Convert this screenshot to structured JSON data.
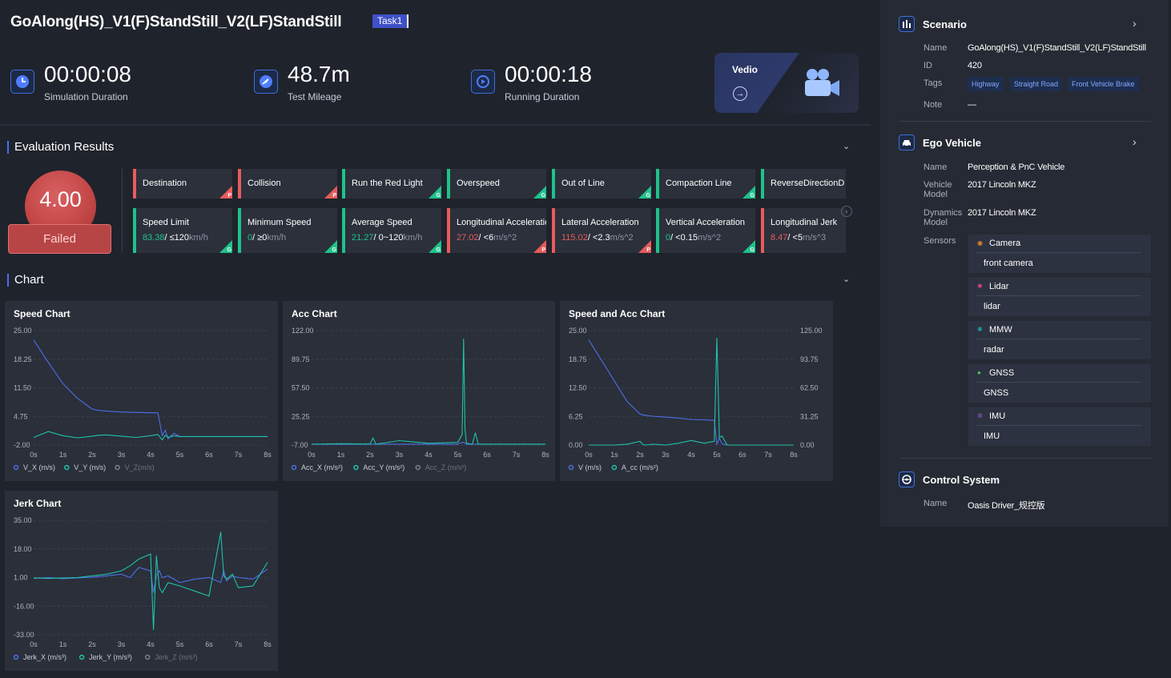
{
  "header": {
    "title": "GoAlong(HS)_V1(F)StandStill_V2(LF)StandStill",
    "task": "Task1"
  },
  "metrics": [
    {
      "value": "00:00:08",
      "label": "Simulation Duration",
      "icon": "clock-icon"
    },
    {
      "value": "48.7m",
      "label": "Test Mileage",
      "icon": "gauge-icon"
    },
    {
      "value": "00:00:18",
      "label": "Running Duration",
      "icon": "replay-icon"
    }
  ],
  "vedio": {
    "label": "Vedio"
  },
  "evaluation": {
    "title": "Evaluation Results",
    "score": "4.00",
    "status": "Failed",
    "colors": {
      "fail": "#e85b5b",
      "pass": "#1fc28a"
    },
    "row1": [
      {
        "name": "Destination",
        "flag": "P",
        "pass": false
      },
      {
        "name": "Collision",
        "flag": "P",
        "pass": false
      },
      {
        "name": "Run the Red Light",
        "flag": "G",
        "pass": true
      },
      {
        "name": "Overspeed",
        "flag": "G",
        "pass": true
      },
      {
        "name": "Out of Line",
        "flag": "G",
        "pass": true
      },
      {
        "name": "Compaction Line",
        "flag": "G",
        "pass": true
      },
      {
        "name": "ReverseDirectionD",
        "flag": "G",
        "pass": true
      }
    ],
    "row2": [
      {
        "name": "Speed Limit",
        "value": "83.38",
        "limit": "/ ≤120",
        "unit": "km/h",
        "flag": "G",
        "pass": true
      },
      {
        "name": "Minimum Speed",
        "value": "0",
        "limit": "/ ≥0",
        "unit": "km/h",
        "flag": "G",
        "pass": true
      },
      {
        "name": "Average Speed",
        "value": "21.27",
        "limit": "/ 0~120",
        "unit": "km/h",
        "flag": "G",
        "pass": true
      },
      {
        "name": "Longitudinal Acceleration",
        "value": "27.02",
        "limit": "/ <6",
        "unit": "m/s^2",
        "flag": "P",
        "pass": false
      },
      {
        "name": "Lateral Acceleration",
        "value": "115.02",
        "limit": "/ <2.3",
        "unit": "m/s^2",
        "flag": "P",
        "pass": false
      },
      {
        "name": "Vertical Acceleration",
        "value": "0",
        "limit": "/ <0.15",
        "unit": "m/s^2",
        "flag": "G",
        "pass": true
      },
      {
        "name": "Longitudinal Jerk",
        "value": "8.47",
        "limit": "/ <5",
        "unit": "m/s^3",
        "flag": "P",
        "pass": false
      }
    ]
  },
  "chart_section": {
    "title": "Chart"
  },
  "chart_data": [
    {
      "type": "line",
      "title": "Speed Chart",
      "x": [
        0,
        0.5,
        1,
        1.5,
        2,
        2.2,
        2.5,
        3,
        3.5,
        4,
        4.25,
        4.4,
        4.5,
        4.6,
        4.8,
        5,
        6,
        7,
        8
      ],
      "xticks": [
        "0s",
        "1s",
        "2s",
        "3s",
        "4s",
        "5s",
        "6s",
        "7s",
        "8s"
      ],
      "yticks": [
        "25.00",
        "18.25",
        "11.50",
        "4.75",
        "-2.00"
      ],
      "ylim": [
        -2,
        25
      ],
      "grid": true,
      "legend": "bottom-left",
      "series": [
        {
          "name": "V_X (m/s)",
          "color": "#4f6ee8",
          "values": [
            22.8,
            17.5,
            12.5,
            9,
            6.5,
            6.2,
            6,
            5.8,
            5.7,
            5.6,
            5.6,
            0.2,
            1.5,
            -0.5,
            0.8,
            0,
            0,
            0,
            0
          ]
        },
        {
          "name": "V_Y (m/s)",
          "color": "#1fc2a8",
          "values": [
            -0.2,
            1.2,
            0.2,
            -0.3,
            0.1,
            0.3,
            0.4,
            0.1,
            -0.2,
            0.2,
            0.5,
            -0.8,
            0.3,
            -0.2,
            0.2,
            0,
            0,
            0,
            0
          ]
        },
        {
          "name": "V_Z(m/s)",
          "color": "#7a8190",
          "values": [],
          "dimmed": true
        }
      ]
    },
    {
      "type": "line",
      "title": "Acc Chart",
      "x": [
        0,
        1,
        2,
        2.1,
        2.2,
        3,
        4,
        5,
        5.15,
        5.2,
        5.25,
        5.3,
        5.5,
        5.6,
        5.7,
        6,
        7,
        8
      ],
      "xticks": [
        "0s",
        "1s",
        "2s",
        "3s",
        "4s",
        "5s",
        "6s",
        "7s",
        "8s"
      ],
      "yticks": [
        "122.00",
        "89.75",
        "57.50",
        "25.25",
        "-7.00"
      ],
      "ylim": [
        -7,
        122
      ],
      "grid": true,
      "legend": "bottom-left",
      "series": [
        {
          "name": "Acc_X (m/s²)",
          "color": "#4f6ee8",
          "values": [
            -6,
            -6,
            -6,
            -6,
            -6,
            -6,
            -6,
            -6,
            -4,
            -4,
            -5,
            -6,
            -6,
            -6,
            -6,
            -6,
            -6,
            -6
          ]
        },
        {
          "name": "Acc_Y (m/s²)",
          "color": "#1fc2a8",
          "values": [
            -6,
            -5.5,
            -5.8,
            1,
            -6,
            -2,
            -5,
            -4,
            5,
            113,
            10,
            -5,
            -6,
            7,
            -6,
            -6,
            -6,
            -6
          ]
        },
        {
          "name": "Acc_Z (m/s²)",
          "color": "#7a8190",
          "values": [],
          "dimmed": true
        }
      ]
    },
    {
      "type": "line",
      "title": "Speed and Acc Chart",
      "x": [
        0,
        0.5,
        1,
        1.5,
        2,
        2.1,
        2.2,
        2.5,
        3,
        3.5,
        4,
        4.5,
        4.9,
        5,
        5.1,
        5.2,
        5.4,
        6,
        7,
        8
      ],
      "xticks": [
        "0s",
        "1s",
        "2s",
        "3s",
        "4s",
        "5s",
        "6s",
        "7s",
        "8s"
      ],
      "yticks": [
        "25.00",
        "18.75",
        "12.50",
        "6.25",
        "0.00"
      ],
      "yticks_right": [
        "125.00",
        "93.75",
        "62.50",
        "31.25",
        "0.00"
      ],
      "ylim": [
        0,
        25
      ],
      "ylim_right": [
        0,
        125
      ],
      "grid": true,
      "legend": "bottom-left",
      "series": [
        {
          "name": "V (m/s)",
          "color": "#4f6ee8",
          "values": [
            23,
            18.5,
            14,
            9.5,
            6.8,
            6.6,
            6.5,
            6.3,
            6.1,
            5.9,
            5.6,
            5.5,
            5.4,
            0.2,
            1.5,
            0.3,
            0,
            0,
            0,
            0
          ],
          "axis": "left"
        },
        {
          "name": "A_cc (m/s²)",
          "color": "#1fc2a8",
          "values": [
            0,
            0,
            0,
            1,
            4,
            1,
            0,
            1,
            0,
            2,
            5,
            2,
            4,
            117,
            8,
            10,
            0,
            0,
            0,
            0
          ],
          "axis": "right"
        }
      ]
    },
    {
      "type": "line",
      "title": "Jerk Chart",
      "x": [
        0,
        0.5,
        1,
        1.5,
        2,
        2.5,
        3,
        3.3,
        3.6,
        4,
        4.1,
        4.2,
        4.3,
        4.4,
        4.6,
        5,
        5.5,
        6,
        6.4,
        6.5,
        6.6,
        6.8,
        7,
        7.5,
        8
      ],
      "xticks": [
        "0s",
        "1s",
        "2s",
        "3s",
        "4s",
        "5s",
        "6s",
        "7s",
        "8s"
      ],
      "yticks": [
        "35.00",
        "18.00",
        "1.00",
        "-16.00",
        "-33.00"
      ],
      "ylim": [
        -33,
        35
      ],
      "grid": true,
      "legend": "bottom-left",
      "series": [
        {
          "name": "Jerk_X (m/s³)",
          "color": "#4f6ee8",
          "values": [
            0.5,
            1,
            0.3,
            0.8,
            1.2,
            2,
            3,
            1,
            7,
            5,
            -8,
            2,
            5,
            1,
            2,
            -2,
            0,
            1,
            -2,
            5,
            -1,
            2,
            1,
            0,
            6
          ]
        },
        {
          "name": "Jerk_Y (m/s³)",
          "color": "#1fc2a8",
          "values": [
            0.8,
            0.5,
            0.7,
            1,
            2,
            3,
            5,
            8,
            12,
            15,
            -30,
            14,
            -5,
            -8,
            -2,
            -4,
            -7,
            -10,
            28,
            2,
            0,
            3,
            -5,
            -4,
            10
          ]
        },
        {
          "name": "Jerk_Z (m/s³)",
          "color": "#7a8190",
          "values": [],
          "dimmed": true
        }
      ]
    }
  ],
  "side": {
    "scenario": {
      "title": "Scenario",
      "name_label": "Name",
      "name": "GoAlong(HS)_V1(F)StandStill_V2(LF)StandStill",
      "id_label": "ID",
      "id": "420",
      "tags_label": "Tags",
      "tags": [
        "Highway",
        "Straight Road",
        "Front Vehicle Brake"
      ],
      "note_label": "Note",
      "note": "—"
    },
    "ego": {
      "title": "Ego Vehicle",
      "name_label": "Name",
      "name": "Perception & PnC Vehicle",
      "vehicle_label_1": "Vehicle",
      "vehicle_label_2": "Model",
      "vehicle_model": "2017 Lincoln MKZ",
      "dyn_label_1": "Dynamics",
      "dyn_label_2": "Model",
      "dyn_model": "2017 Lincoln MKZ",
      "sensors_label": "Sensors",
      "sensors": [
        {
          "type": "Camera",
          "value": "front camera",
          "color": "#f08a24"
        },
        {
          "type": "Lidar",
          "value": "lidar",
          "color": "#e0447e"
        },
        {
          "type": "MMW",
          "value": "radar",
          "color": "#1fb8c8"
        },
        {
          "type": "GNSS",
          "value": "GNSS",
          "color": "#4cc94c"
        },
        {
          "type": "IMU",
          "value": "IMU",
          "color": "#9a5fe0"
        }
      ]
    },
    "control": {
      "title": "Control System",
      "name_label": "Name",
      "name": "Oasis Driver_规控版"
    }
  }
}
